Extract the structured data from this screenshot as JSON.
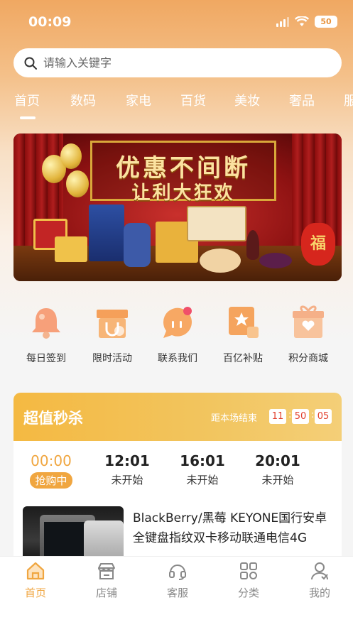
{
  "status_bar": {
    "time": "00:09",
    "battery": "50"
  },
  "search": {
    "placeholder": "请输入关键字"
  },
  "categories": [
    {
      "label": "首页",
      "active": true
    },
    {
      "label": "数码"
    },
    {
      "label": "家电"
    },
    {
      "label": "百货"
    },
    {
      "label": "美妆"
    },
    {
      "label": "奢品"
    },
    {
      "label": "服"
    }
  ],
  "banner": {
    "line1": "优惠不间断",
    "line2": "让利大狂欢",
    "bag_char": "福"
  },
  "quick_menu": [
    {
      "label": "每日签到",
      "icon": "bell-icon"
    },
    {
      "label": "限时活动",
      "icon": "gift-box-icon"
    },
    {
      "label": "联系我们",
      "icon": "chat-bubble-icon"
    },
    {
      "label": "百亿补贴",
      "icon": "star-thumb-icon"
    },
    {
      "label": "积分商城",
      "icon": "gift-heart-icon"
    }
  ],
  "flash_sale": {
    "title": "超值秒杀",
    "ends_label": "距本场结束",
    "countdown": [
      "11",
      "50",
      "05"
    ],
    "slots": [
      {
        "time": "00:00",
        "status": "抢购中",
        "active": true
      },
      {
        "time": "12:01",
        "status": "未开始"
      },
      {
        "time": "16:01",
        "status": "未开始"
      },
      {
        "time": "20:01",
        "status": "未开始"
      }
    ],
    "product": {
      "title": "BlackBerry/黑莓 KEYONE国行安卓全键盘指纹双卡移动联通电信4G"
    }
  },
  "tabbar": [
    {
      "label": "首页",
      "icon": "home-icon",
      "active": true
    },
    {
      "label": "店铺",
      "icon": "store-icon"
    },
    {
      "label": "客服",
      "icon": "headset-icon"
    },
    {
      "label": "分类",
      "icon": "grid-icon"
    },
    {
      "label": "我的",
      "icon": "user-icon"
    }
  ],
  "colors": {
    "accent": "#f0a640",
    "header": "#f0a862"
  }
}
